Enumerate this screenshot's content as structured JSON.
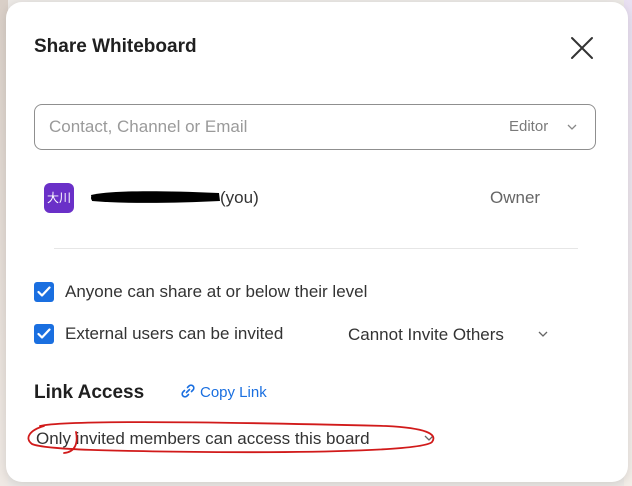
{
  "dialog": {
    "title": "Share Whiteboard"
  },
  "search": {
    "placeholder": "Contact, Channel or Email",
    "value": "",
    "role": "Editor"
  },
  "members": [
    {
      "avatar_text": "大川",
      "you_label": "(you)",
      "role": "Owner"
    }
  ],
  "options": {
    "share_label": "Anyone can share at or below their level",
    "share_checked": true,
    "external_label": "External users can be invited",
    "external_checked": true,
    "invite_permission": "Cannot Invite Others"
  },
  "link_access": {
    "title": "Link Access",
    "copy_link_label": "Copy Link",
    "access_level": "Only invited members can access this board"
  },
  "colors": {
    "accent": "#1a6fe0",
    "avatar": "#6a30c8",
    "annotation": "#d11a1a"
  }
}
